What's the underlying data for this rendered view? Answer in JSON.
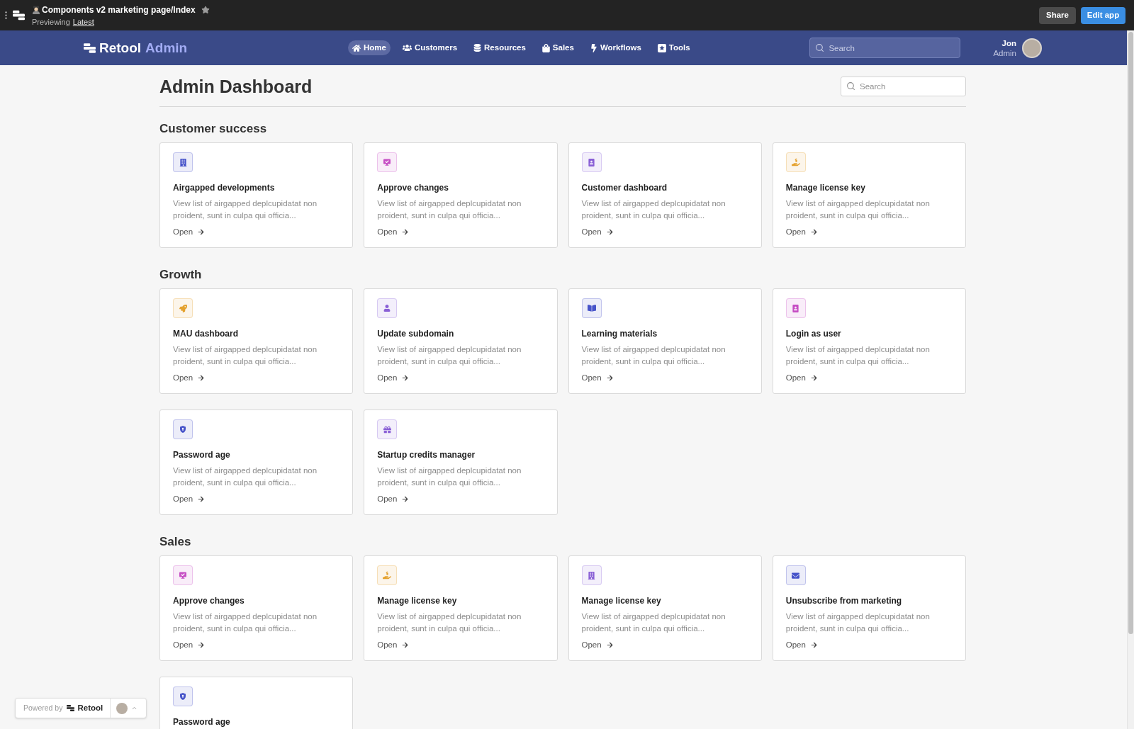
{
  "top_bar": {
    "title": "Components v2 marketing page/Index",
    "preview_label": "Previewing",
    "version": "Latest",
    "buttons": [
      {
        "label": "Share",
        "kind": "secondary"
      },
      {
        "label": "Edit app",
        "kind": "primary"
      }
    ]
  },
  "nav": {
    "logo": "Retool",
    "logo_suffix": "Admin",
    "items": [
      {
        "label": "Home",
        "selected": true
      },
      {
        "label": "Customers",
        "selected": false
      },
      {
        "label": "Resources",
        "selected": false
      },
      {
        "label": "Sales",
        "selected": false
      },
      {
        "label": "Workflows",
        "selected": false
      },
      {
        "label": "Tools",
        "selected": false
      }
    ],
    "search": {
      "placeholder": "Search"
    },
    "user": {
      "name": "Jon",
      "role": "Admin"
    }
  },
  "page": {
    "title": "Admin Dashboard",
    "search": {
      "placeholder": "Search"
    }
  },
  "sections": [
    {
      "title": "Customer success",
      "cards": [
        {
          "title": "Airgapped developments",
          "description": "View list of airgapped deplcupidatat non proident, sunt in culpa qui officia...",
          "link": "Open",
          "color": "#4653c9"
        },
        {
          "title": "Approve changes",
          "description": "View list of airgapped deplcupidatat non proident, sunt in culpa qui officia...",
          "link": "Open",
          "color": "#c64ec4"
        },
        {
          "title": "Customer dashboard",
          "description": "View list of airgapped deplcupidatat non proident, sunt in culpa qui officia...",
          "link": "Open",
          "color": "#8a60d6"
        },
        {
          "title": "Manage license key",
          "description": "View list of airgapped deplcupidatat non proident, sunt in culpa qui officia...",
          "link": "Open",
          "color": "#e4a12d"
        }
      ]
    },
    {
      "title": "Growth",
      "cards": [
        {
          "title": "MAU dashboard",
          "description": "View list of airgapped deplcupidatat non proident, sunt in culpa qui officia...",
          "link": "Open",
          "color": "#e4a12d"
        },
        {
          "title": "Update subdomain",
          "description": "View list of airgapped deplcupidatat non proident, sunt in culpa qui officia...",
          "link": "Open",
          "color": "#8a60d6"
        },
        {
          "title": "Learning materials",
          "description": "View list of airgapped deplcupidatat non proident, sunt in culpa qui officia...",
          "link": "Open",
          "color": "#4653c9"
        },
        {
          "title": "Login as user",
          "description": "View list of airgapped deplcupidatat non proident, sunt in culpa qui officia...",
          "link": "Open",
          "color": "#c64ec4"
        },
        {
          "title": "Password age",
          "description": "View list of airgapped deplcupidatat non proident, sunt in culpa qui officia...",
          "link": "Open",
          "color": "#4653c9"
        },
        {
          "title": "Startup credits manager",
          "description": "View list of airgapped deplcupidatat non proident, sunt in culpa qui officia...",
          "link": "Open",
          "color": "#8a60d6"
        }
      ]
    },
    {
      "title": "Sales",
      "cards": [
        {
          "title": "Approve changes",
          "description": "View list of airgapped deplcupidatat non proident, sunt in culpa qui officia...",
          "link": "Open",
          "color": "#c64ec4"
        },
        {
          "title": "Manage license key",
          "description": "View list of airgapped deplcupidatat non proident, sunt in culpa qui officia...",
          "link": "Open",
          "color": "#e4a12d"
        },
        {
          "title": "Manage license key",
          "description": "View list of airgapped deplcupidatat non proident, sunt in culpa qui officia...",
          "link": "Open",
          "color": "#8a60d6"
        },
        {
          "title": "Unsubscribe from marketing",
          "description": "View list of airgapped deplcupidatat non proident, sunt in culpa qui officia...",
          "link": "Open",
          "color": "#4653c9"
        },
        {
          "title": "Password age",
          "color": "#4653c9"
        }
      ]
    }
  ],
  "powered_by": {
    "label": "Powered by",
    "brand": "Retool"
  }
}
